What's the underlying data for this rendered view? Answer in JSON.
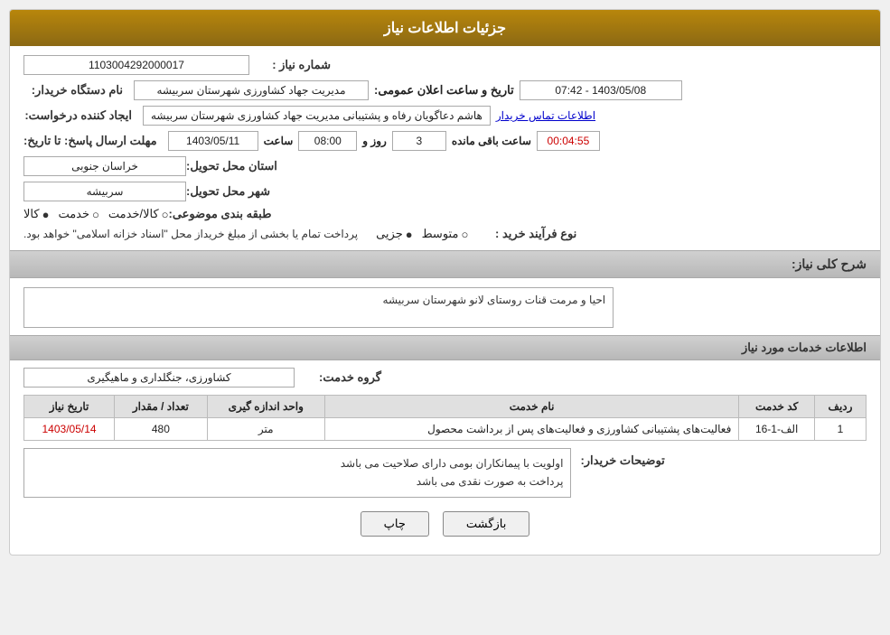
{
  "header": {
    "title": "جزئیات اطلاعات نیاز"
  },
  "fields": {
    "need_number_label": "شماره نیاز :",
    "need_number_value": "1103004292000017",
    "buyer_org_label": "نام دستگاه خریدار:",
    "buyer_org_value": "مدیریت جهاد کشاورزی شهرستان سربیشه",
    "requester_label": "ایجاد کننده درخواست:",
    "requester_value": "هاشم دعاگویان  رفاه و پشتیبانی مدیریت جهاد کشاورزی شهرستان سربیشه",
    "contact_link": "اطلاعات تماس خریدار",
    "submit_deadline_label": "مهلت ارسال پاسخ: تا تاریخ:",
    "submit_date": "1403/05/11",
    "submit_time_label": "ساعت",
    "submit_time": "08:00",
    "submit_days_label": "روز و",
    "submit_days": "3",
    "submit_countdown_label": "ساعت باقی مانده",
    "submit_countdown": "00:04:55",
    "announce_datetime_label": "تاریخ و ساعت اعلان عمومی:",
    "announce_datetime": "1403/05/08 - 07:42",
    "province_label": "استان محل تحویل:",
    "province_value": "خراسان جنوبی",
    "city_label": "شهر محل تحویل:",
    "city_value": "سربیشه",
    "category_label": "طبقه بندی موضوعی:",
    "category_kala": "کالا",
    "category_khadamat": "خدمت",
    "category_kala_khadamat": "کالا/خدمت",
    "purchase_type_label": "نوع فرآیند خرید :",
    "purchase_type_jozyi": "جزیی",
    "purchase_type_motawaset": "متوسط",
    "purchase_type_desc": "پرداخت تمام یا بخشی از مبلغ خریداز محل \"اسناد خزانه اسلامی\" خواهد بود.",
    "need_desc_label": "شرح کلی نیاز:",
    "need_desc_value": "احیا و مرمت قنات روستای لانو شهرستان سربیشه",
    "service_info_label": "اطلاعات خدمات مورد نیاز",
    "service_group_label": "گروه خدمت:",
    "service_group_value": "کشاورزی، جنگلداری و ماهیگیری",
    "table": {
      "headers": [
        "ردیف",
        "کد خدمت",
        "نام خدمت",
        "واحد اندازه گیری",
        "تعداد / مقدار",
        "تاریخ نیاز"
      ],
      "rows": [
        {
          "row_num": "1",
          "service_code": "الف-1-16",
          "service_name": "فعالیت‌های پشتیبانی کشاورزی و فعالیت‌های پس از برداشت محصول",
          "unit": "متر",
          "quantity": "480",
          "date": "1403/05/14"
        }
      ]
    },
    "buyer_desc_label": "توضیحات خریدار:",
    "buyer_desc_value": "اولویت با پیمانکاران بومی دارای صلاحیت  می باشد\nپرداخت به صورت نقدی می باشد",
    "btn_print": "چاپ",
    "btn_back": "بازگشت"
  },
  "icons": {
    "radio_selected": "●",
    "radio_unselected": "○"
  }
}
